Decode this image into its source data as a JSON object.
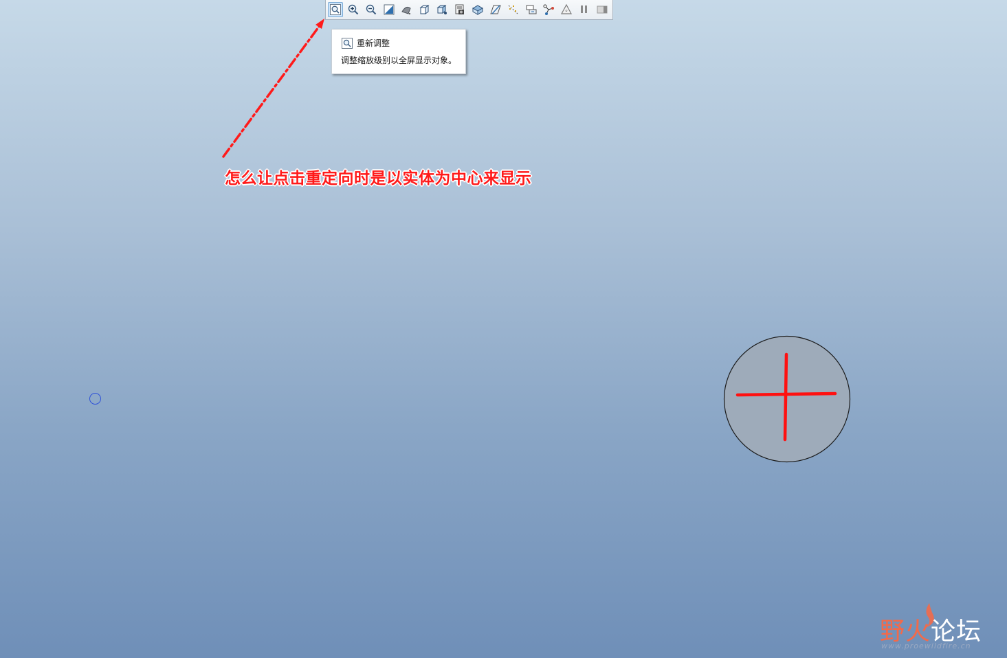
{
  "toolbar": {
    "buttons": [
      {
        "name": "refit-button",
        "icon": "refit-zoom-icon",
        "active": true
      },
      {
        "name": "zoom-in-button",
        "icon": "zoom-in-icon"
      },
      {
        "name": "zoom-out-button",
        "icon": "zoom-out-icon"
      },
      {
        "name": "repaint-button",
        "icon": "repaint-icon"
      },
      {
        "name": "display-style-button",
        "icon": "shading-style-icon"
      },
      {
        "name": "saved-orientations-button",
        "icon": "saved-views-icon"
      },
      {
        "name": "view-manager-button",
        "icon": "view-manager-icon"
      },
      {
        "name": "perspective-button",
        "icon": "perspective-icon"
      },
      {
        "name": "section-button",
        "icon": "section-icon"
      },
      {
        "name": "datum-planes-button",
        "icon": "datum-plane-icon"
      },
      {
        "name": "datum-axes-button",
        "icon": "datum-axis-icon"
      },
      {
        "name": "datum-points-button",
        "icon": "datum-point-icon"
      },
      {
        "name": "csys-button",
        "icon": "coordinate-system-icon"
      },
      {
        "name": "annotations-button",
        "icon": "annotation-icon"
      },
      {
        "name": "pause-button",
        "icon": "pause-icon"
      },
      {
        "name": "regenerate-button",
        "icon": "regenerate-icon"
      }
    ]
  },
  "tooltip": {
    "title": "重新调整",
    "description": "调整缩放级别以全屏显示对象。"
  },
  "annotation": {
    "text": "怎么让点击重定向时是以实体为中心来显示",
    "color": "#ff1a1a"
  },
  "watermark": {
    "name_part1": "野火",
    "name_part2": "论坛",
    "url": "www.proewildfire.cn"
  },
  "colors": {
    "background_top": "#c6d9e8",
    "background_bottom": "#6f8fb8",
    "model_fill": "#9eabba",
    "model_cross": "#ff1010"
  }
}
